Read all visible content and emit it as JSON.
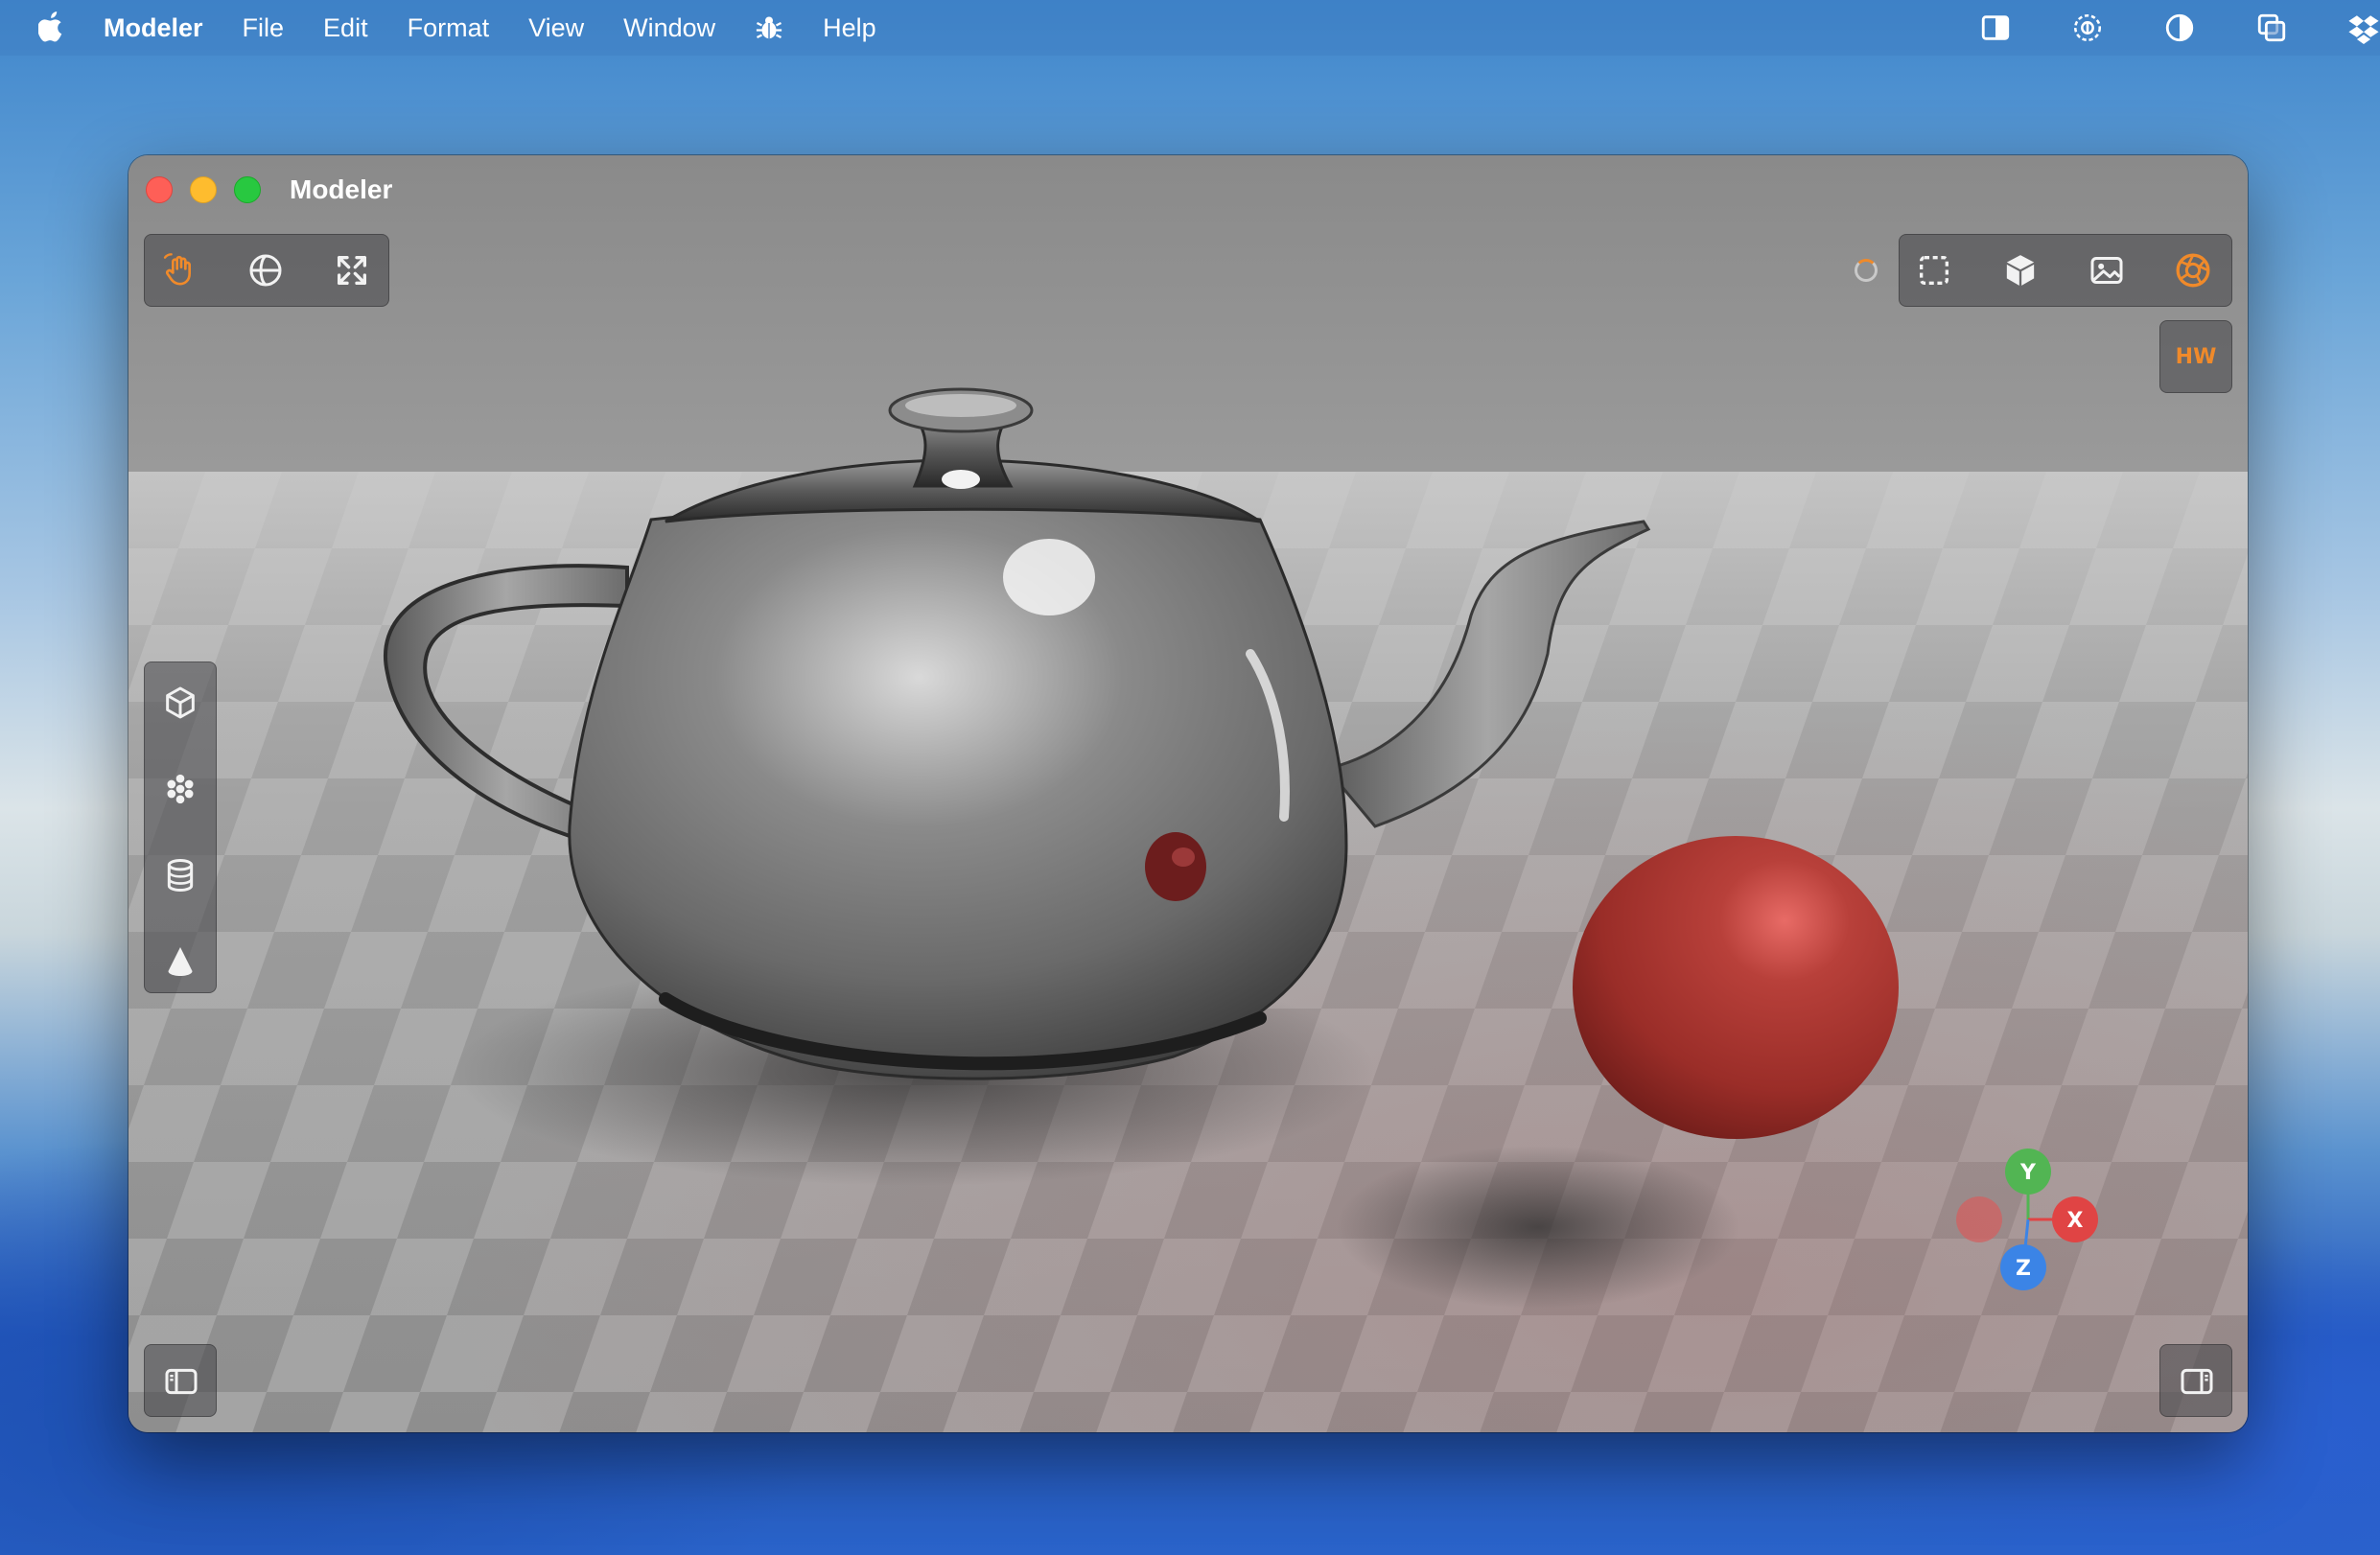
{
  "menubar": {
    "app_name": "Modeler",
    "items": [
      "File",
      "Edit",
      "Format",
      "View",
      "Window",
      "Help"
    ],
    "status_icons": [
      "sidebar-toggle-icon",
      "dynamic-island-icon",
      "contrast-icon",
      "window-stack-icon",
      "dropbox-icon"
    ]
  },
  "window": {
    "title": "Modeler",
    "top_toolbar_left": [
      "hand-pan-icon",
      "globe-orbit-icon",
      "expand-fit-icon"
    ],
    "top_toolbar_right": [
      "marquee-select-icon",
      "cube-solid-icon",
      "image-icon",
      "aperture-icon"
    ],
    "render_mode_label": "HW",
    "side_toolbar": [
      "cube-outline-icon",
      "particles-icon",
      "cylinder-icon",
      "cone-icon"
    ],
    "axis_gizmo": {
      "y": "Y",
      "x": "X",
      "z": "Z"
    },
    "colors": {
      "accent": "#f08a2a",
      "axis_x": "#e04444",
      "axis_y": "#52b553",
      "axis_z": "#3b84e6",
      "sphere": "#a8322d"
    }
  }
}
